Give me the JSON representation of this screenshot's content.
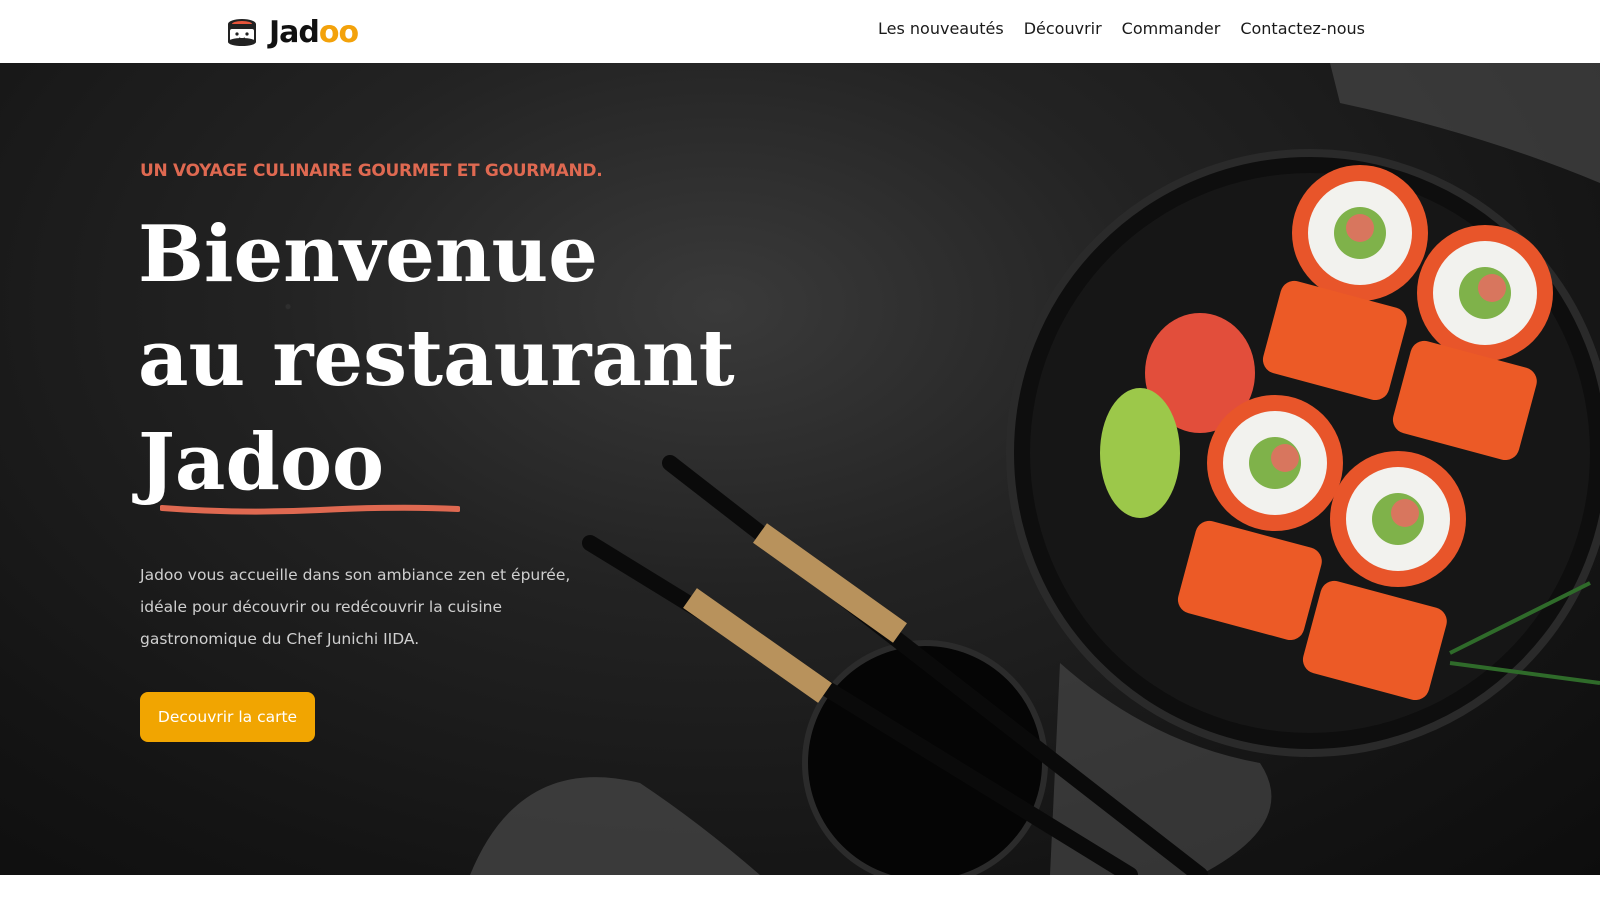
{
  "brand": {
    "name_prefix": "Jad",
    "name_suffix": "oo",
    "accent_color": "#f3a20b"
  },
  "nav": {
    "items": [
      {
        "label": "Les nouveautés"
      },
      {
        "label": "Découvrir"
      },
      {
        "label": "Commander"
      },
      {
        "label": "Contactez-nous"
      }
    ]
  },
  "hero": {
    "eyebrow": "UN VOYAGE CULINAIRE GOURMET ET GOURMAND.",
    "title_line1": "Bienvenue",
    "title_line2": "au restaurant",
    "title_line3": "Jadoo",
    "description": "Jadoo vous accueille dans son ambiance zen et épurée, idéale pour découvrir ou redécouvrir la cuisine gastronomique du Chef Junichi IIDA.",
    "cta_label": "Decouvrir la carte",
    "eyebrow_color": "#df6951",
    "cta_color": "#f1a501"
  },
  "icons": {
    "logo": "sushi-logo-icon"
  }
}
